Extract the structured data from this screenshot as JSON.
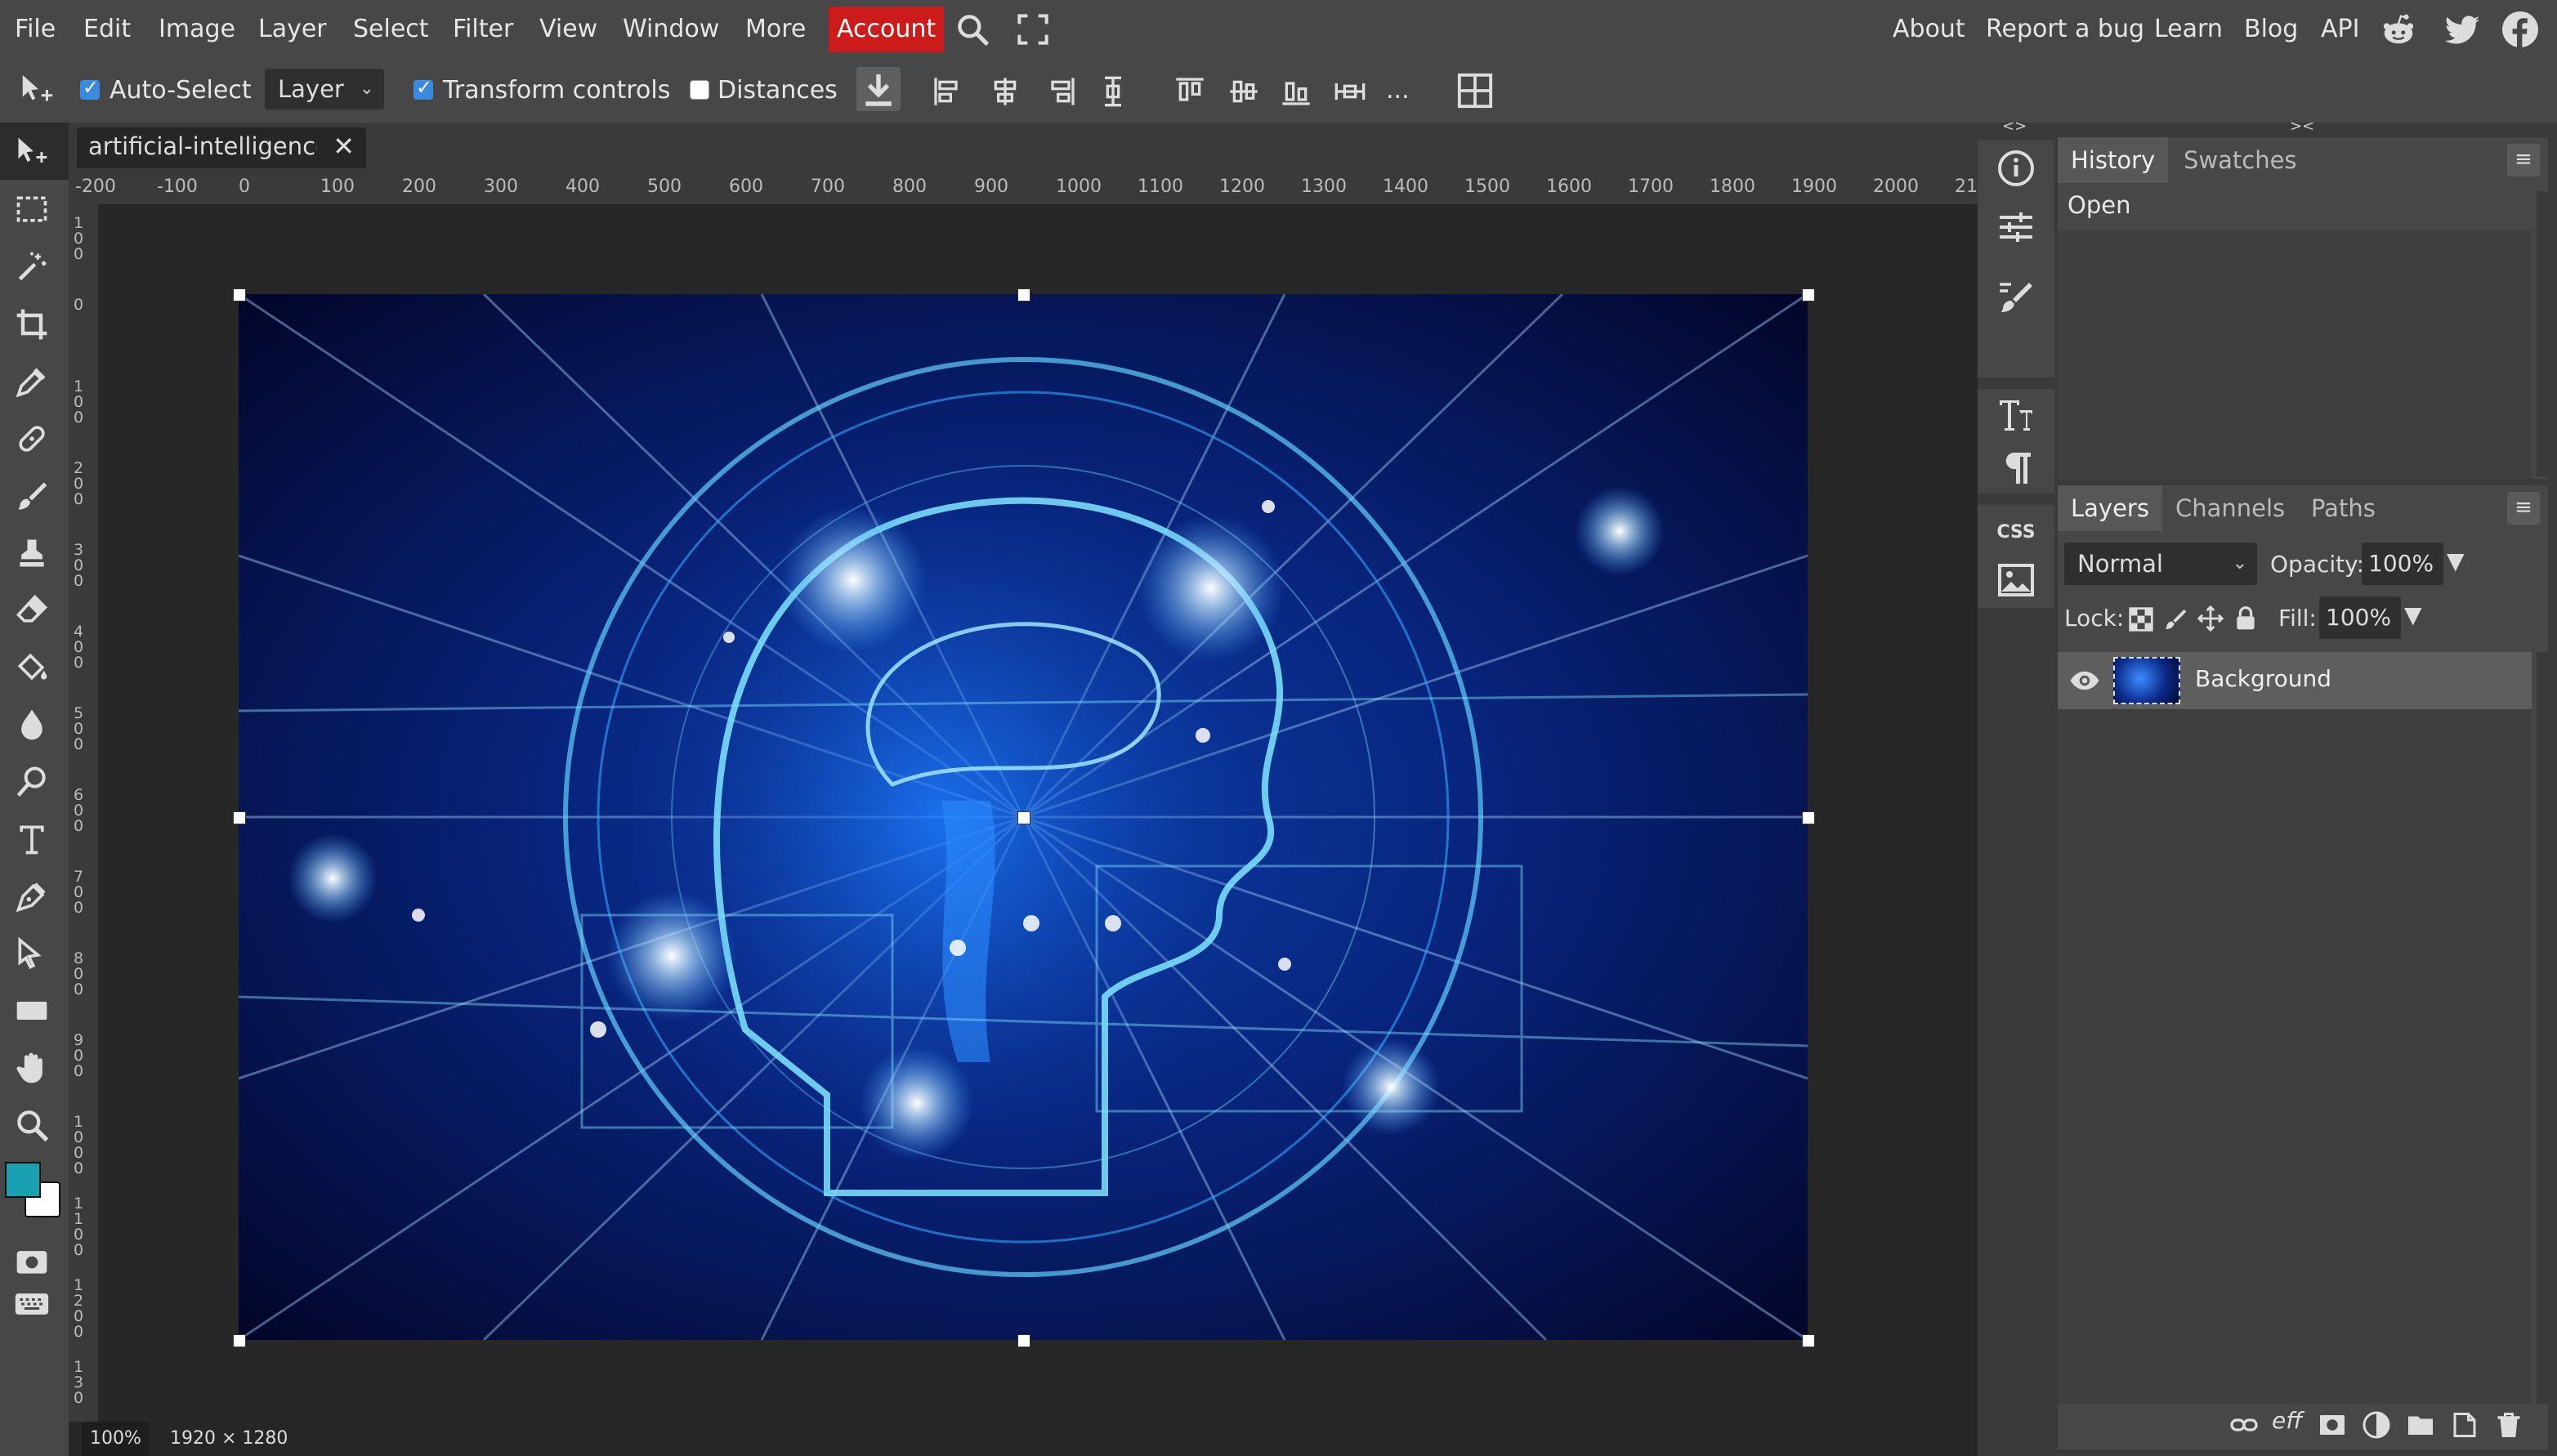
{
  "menu": {
    "items": [
      "File",
      "Edit",
      "Image",
      "Layer",
      "Select",
      "Filter",
      "View",
      "Window",
      "More"
    ],
    "account": "Account",
    "right_links": [
      "About",
      "Report a bug",
      "Learn",
      "Blog",
      "API"
    ]
  },
  "options": {
    "auto_select_label": "Auto-Select",
    "auto_select_checked": true,
    "layer_select_value": "Layer",
    "transform_controls_label": "Transform controls",
    "transform_controls_checked": true,
    "distances_label": "Distances",
    "distances_checked": false,
    "more_label": "..."
  },
  "document": {
    "tab_title": "artificial-intelligence",
    "close_glyph": "✕",
    "zoom": "100%",
    "dimensions": "1920 × 1280",
    "ruler_h": [
      "-200",
      "-100",
      "0",
      "100",
      "200",
      "300",
      "400",
      "500",
      "600",
      "700",
      "800",
      "900",
      "1000",
      "1100",
      "1200",
      "1300",
      "1400",
      "1500",
      "1600",
      "1700",
      "1800",
      "1900",
      "2000",
      "21"
    ],
    "ruler_v": [
      "100",
      "0",
      "100",
      "200",
      "300",
      "400",
      "500",
      "600",
      "700",
      "800",
      "900",
      "1000",
      "1100",
      "1200",
      "130"
    ]
  },
  "colors": {
    "foreground": "#1aa0b0",
    "background": "#ffffff",
    "account_red": "#cc1b1b",
    "checkbox_blue": "#3a8be0"
  },
  "panels": {
    "history": {
      "tabs": [
        "History",
        "Swatches"
      ],
      "items": [
        "Open"
      ]
    },
    "layers": {
      "tabs": [
        "Layers",
        "Channels",
        "Paths"
      ],
      "blend_mode": "Normal",
      "opacity_label": "Opacity:",
      "opacity_value": "100%",
      "lock_label": "Lock:",
      "fill_label": "Fill:",
      "fill_value": "100%",
      "layers": [
        {
          "name": "Background",
          "visible": true
        }
      ],
      "footer_eff": "eff"
    },
    "mini_collapse_left": "<>",
    "mini_collapse_right": "><"
  }
}
